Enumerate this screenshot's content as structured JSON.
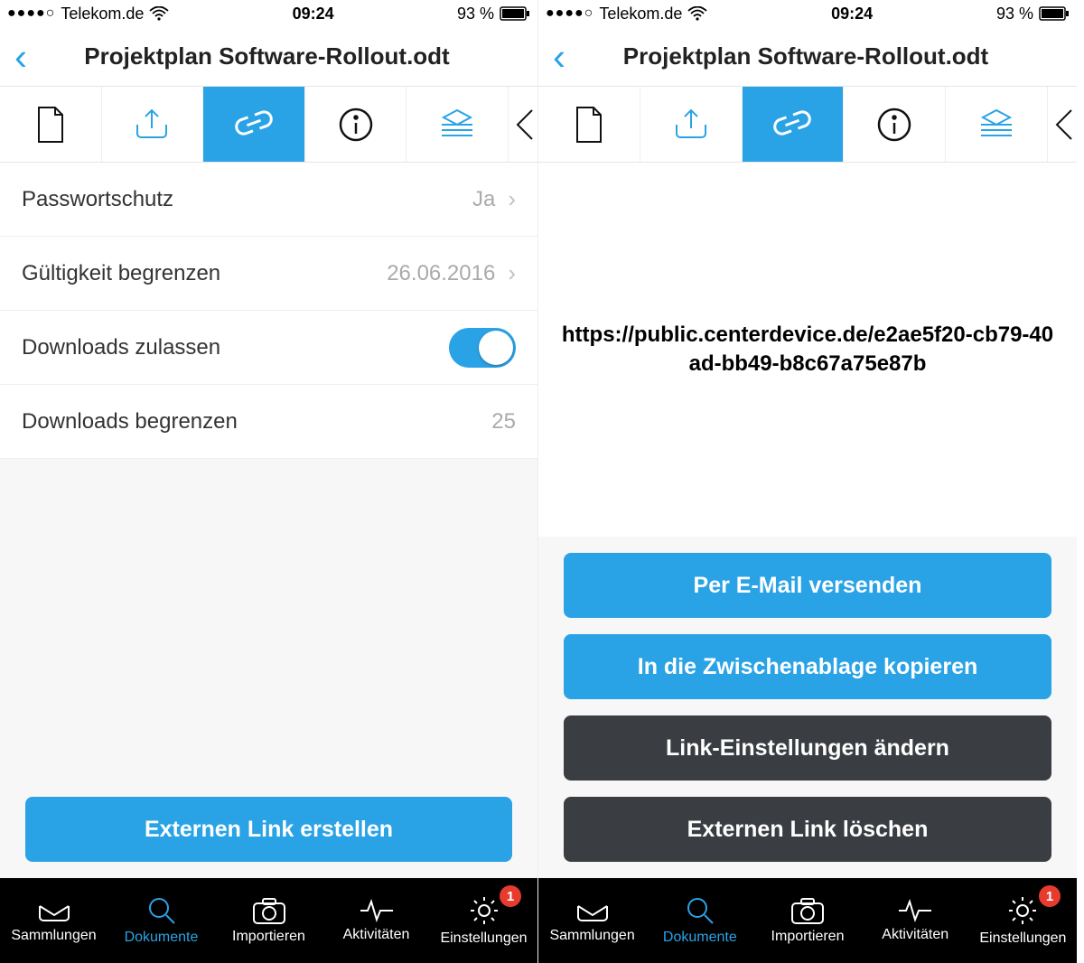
{
  "status": {
    "carrier": "Telekom.de",
    "time": "09:24",
    "battery": "93 %",
    "signal_dots": "●●●●○"
  },
  "header": {
    "title": "Projektplan Software-Rollout.odt"
  },
  "left": {
    "rows": {
      "password_label": "Passwortschutz",
      "password_value": "Ja",
      "validity_label": "Gültigkeit begrenzen",
      "validity_value": "26.06.2016",
      "downloads_allow_label": "Downloads zulassen",
      "downloads_limit_label": "Downloads begrenzen",
      "downloads_limit_value": "25"
    },
    "create_button": "Externen Link erstellen"
  },
  "right": {
    "link_url": "https://public.centerdevice.de/e2ae5f20-cb79-40ad-bb49-b8c67a75e87b",
    "buttons": {
      "email": "Per E-Mail versenden",
      "clipboard": "In die Zwischenablage kopieren",
      "settings": "Link-Einstellungen ändern",
      "delete": "Externen Link löschen"
    }
  },
  "tabbar": {
    "sammlungen": "Sammlungen",
    "dokumente": "Dokumente",
    "importieren": "Importieren",
    "aktivitaeten": "Aktivitäten",
    "einstellungen": "Einstellungen",
    "badge": "1"
  }
}
